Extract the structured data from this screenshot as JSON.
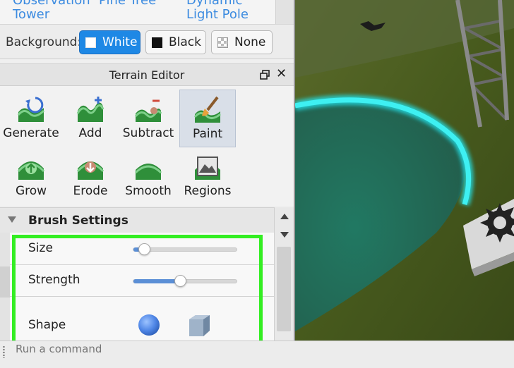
{
  "top_links": [
    {
      "text": "Observation",
      "id": "observation"
    },
    {
      "text": "Pine Tree",
      "id": "pine-tree"
    },
    {
      "text": "Tower",
      "id": "tower"
    },
    {
      "text": "Dynamic",
      "id": "dynamic"
    },
    {
      "text": "Light Pole",
      "id": "light-pole"
    }
  ],
  "background": {
    "label": "Background:",
    "options": [
      "White",
      "Black",
      "None"
    ],
    "selected": "White"
  },
  "terrain_editor": {
    "title": "Terrain Editor",
    "tools": [
      {
        "label": "Generate",
        "icon": "generate-icon"
      },
      {
        "label": "Add",
        "icon": "add-terrain-icon"
      },
      {
        "label": "Subtract",
        "icon": "subtract-terrain-icon"
      },
      {
        "label": "Paint",
        "icon": "paint-icon",
        "selected": true
      },
      {
        "label": "Grow",
        "icon": "grow-icon"
      },
      {
        "label": "Erode",
        "icon": "erode-icon"
      },
      {
        "label": "Smooth",
        "icon": "smooth-icon"
      },
      {
        "label": "Regions",
        "icon": "regions-icon"
      }
    ]
  },
  "brush_settings": {
    "title": "Brush Settings",
    "size_label": "Size",
    "size_value": 0.1,
    "strength_label": "Strength",
    "strength_value": 0.45,
    "shape_label": "Shape",
    "shapes": [
      "sphere",
      "cube"
    ],
    "selected_shape": "sphere"
  },
  "command_bar": {
    "placeholder": "Run a command"
  },
  "colors": {
    "accent": "#1e88e5",
    "highlight": "#33ee22",
    "slider_fill": "#5b8fd6",
    "brush_ring": "#22e0e8",
    "grass": "#4a5a1f"
  }
}
